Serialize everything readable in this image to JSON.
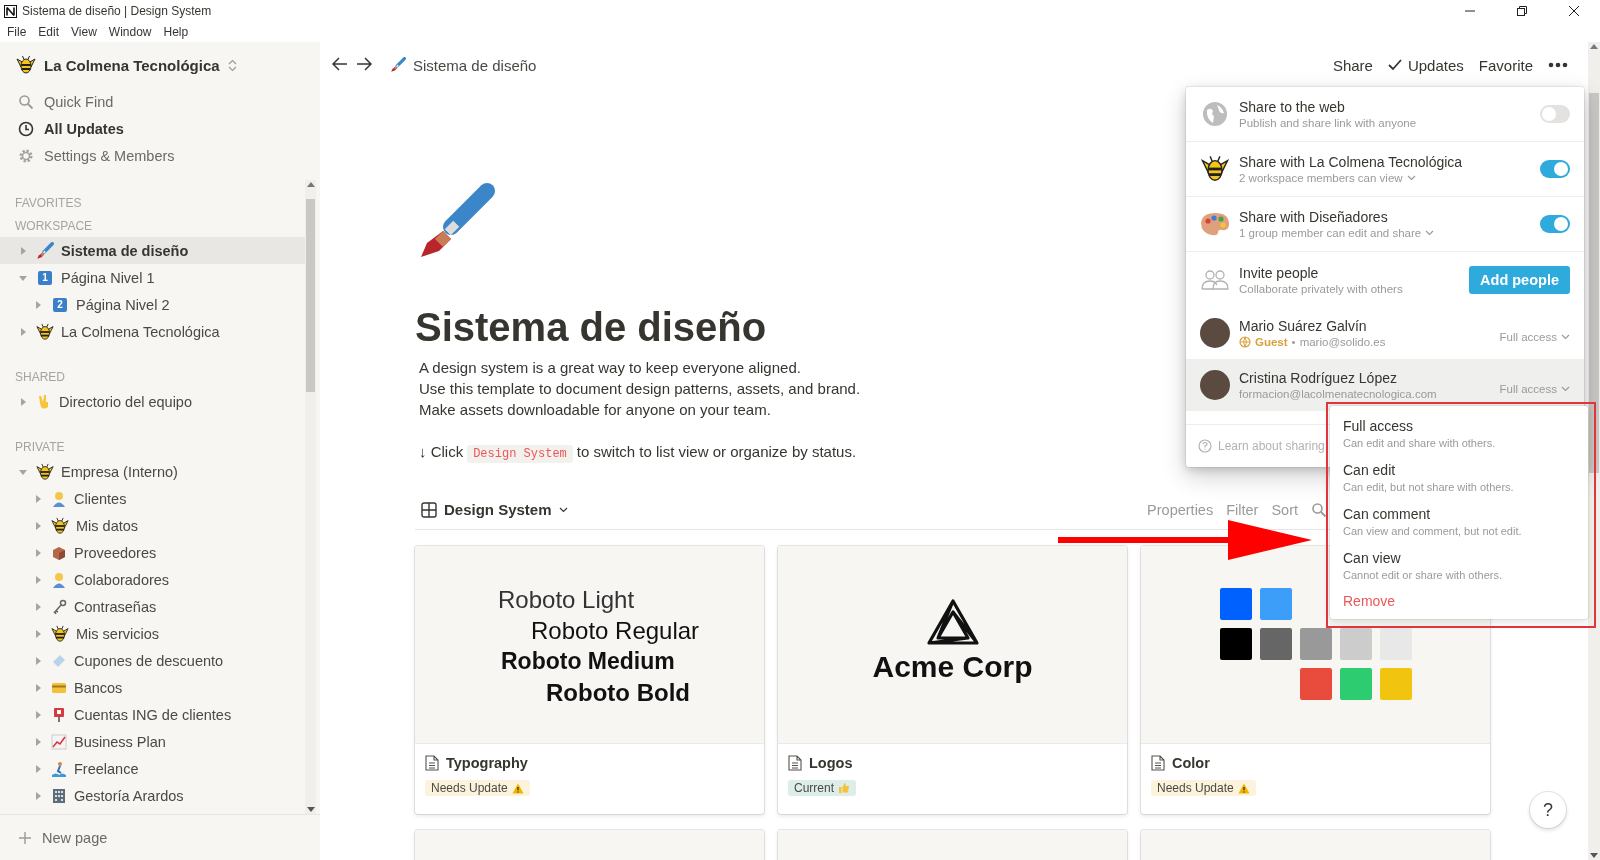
{
  "window": {
    "title": "Sistema de diseño | Design System"
  },
  "menu_bar": [
    "File",
    "Edit",
    "View",
    "Window",
    "Help"
  ],
  "sidebar": {
    "workspace_name": "La Colmena Tecnológica",
    "nav": [
      {
        "label": "Quick Find",
        "selected": false
      },
      {
        "label": "All Updates",
        "selected": true
      },
      {
        "label": "Settings & Members",
        "selected": false
      }
    ],
    "sections": [
      {
        "title": "FAVORITES"
      },
      {
        "title": "WORKSPACE",
        "items": [
          {
            "label": "Sistema de diseño",
            "expanded": false,
            "selected": true
          },
          {
            "label": "Página Nivel 1",
            "badge": "1",
            "expanded": true,
            "selected": false,
            "children": [
              {
                "label": "Página Nivel 2",
                "badge": "2",
                "expanded": false,
                "selected": false
              }
            ]
          },
          {
            "label": "La Colmena Tecnológica",
            "expanded": false,
            "selected": false
          }
        ]
      },
      {
        "title": "SHARED",
        "items": [
          {
            "label": "Directorio del equipo",
            "expanded": false,
            "selected": false
          }
        ]
      },
      {
        "title": "PRIVATE",
        "items": [
          {
            "label": "Empresa (Interno)",
            "expanded": true,
            "selected": false,
            "children": [
              {
                "label": "Clientes",
                "expanded": false,
                "selected": false
              },
              {
                "label": "Mis datos",
                "expanded": false,
                "selected": false
              },
              {
                "label": "Proveedores",
                "expanded": false,
                "selected": false
              },
              {
                "label": "Colaboradores",
                "expanded": false,
                "selected": false
              },
              {
                "label": "Contraseñas",
                "expanded": false,
                "selected": false
              },
              {
                "label": "Mis servicios",
                "expanded": false,
                "selected": false
              },
              {
                "label": "Cupones de descuento",
                "expanded": false,
                "selected": false
              },
              {
                "label": "Bancos",
                "expanded": false,
                "selected": false
              },
              {
                "label": "Cuentas ING de clientes",
                "expanded": false,
                "selected": false
              },
              {
                "label": "Business Plan",
                "expanded": false,
                "selected": false
              },
              {
                "label": "Freelance",
                "expanded": false,
                "selected": false
              },
              {
                "label": "Gestoría Arardos",
                "expanded": false,
                "selected": false
              }
            ]
          }
        ]
      }
    ],
    "new_page": "New page"
  },
  "topbar": {
    "breadcrumb": "Sistema de diseño",
    "actions": [
      {
        "label": "Share",
        "kind": "plain"
      },
      {
        "label": "Updates",
        "kind": "check"
      },
      {
        "label": "Favorite",
        "kind": "plain"
      }
    ]
  },
  "page": {
    "title": "Sistema de diseño",
    "description": [
      "A design system is a great way to keep everyone aligned.",
      "Use this template to document design patterns, assets, and brand.",
      "Make assets downloadable for anyone on your team."
    ],
    "hint": {
      "before": "↓ Click",
      "code": "Design System",
      "after": "to switch to list view or organize by status."
    }
  },
  "database": {
    "view": "Design System",
    "actions": [
      "Properties",
      "Filter",
      "Sort"
    ],
    "cards": [
      {
        "kind": "typography",
        "title": "Typography",
        "lines": [
          {
            "text": "Roboto Light",
            "kind": "light"
          },
          {
            "text": "Roboto Regular",
            "kind": "regular"
          },
          {
            "text": "Roboto Medium",
            "kind": "medium"
          },
          {
            "text": "Roboto Bold",
            "kind": "bold"
          }
        ],
        "tag": {
          "label": "Needs Update",
          "kind": "warning",
          "color": "#fbf3db"
        }
      },
      {
        "kind": "logo",
        "title": "Logos",
        "logo_text": "Acme Corp",
        "tag": {
          "label": "Current",
          "kind": "approval",
          "color": "#ddedea"
        }
      },
      {
        "kind": "swatches",
        "title": "Color",
        "swatch_rows": [
          {
            "kind": "leading",
            "swatches": [
              {
                "color": "#0061fe"
              },
              {
                "color": "#3d9efa"
              }
            ]
          },
          {
            "kind": "leading",
            "swatches": [
              {
                "color": "#000000"
              },
              {
                "color": "#666666"
              },
              {
                "color": "#999999"
              },
              {
                "color": "#cccccc"
              },
              {
                "color": "#e8e8e8"
              }
            ]
          },
          {
            "kind": "trailing",
            "swatches": [
              {
                "color": "#e94c3c"
              },
              {
                "color": "#2ecc71"
              },
              {
                "color": "#f1c40f"
              }
            ]
          }
        ],
        "tag": {
          "label": "Needs Update",
          "kind": "warning",
          "color": "#fbf3db"
        }
      },
      {
        "kind": "cut"
      },
      {
        "kind": "cut"
      },
      {
        "kind": "cut"
      }
    ]
  },
  "share_menu": {
    "options": [
      {
        "title": "Share to the web",
        "subtitle": "Publish and share link with anyone",
        "on": false,
        "dropdown": false
      },
      {
        "title": "Share with La Colmena Tecnológica",
        "subtitle": "2 workspace members can view",
        "on": true,
        "dropdown": true
      },
      {
        "title": "Share with Diseñadores",
        "subtitle": "1 group member can edit and share",
        "on": true,
        "dropdown": true
      }
    ],
    "invite": {
      "title": "Invite people",
      "subtitle": "Collaborate privately with others",
      "button": "Add people"
    },
    "members": [
      {
        "name": "Mario Suárez Galvín",
        "role": "Guest",
        "separator": "•",
        "email": "mario@solido.es",
        "access": "Full access",
        "selected": false
      },
      {
        "name": "Cristina Rodríguez López",
        "email": "formacion@lacolmenatecnologica.com",
        "access": "Full access",
        "selected": true
      }
    ],
    "footer": "Learn about sharing"
  },
  "access_menu": {
    "options": [
      {
        "title": "Full access",
        "description": "Can edit and share with others.",
        "selected": false
      },
      {
        "title": "Can edit",
        "description": "Can edit, but not share with others.",
        "selected": false
      },
      {
        "title": "Can comment",
        "description": "Can view and comment, but not edit.",
        "selected": false
      },
      {
        "title": "Can view",
        "description": "Cannot edit or share with others.",
        "selected": false
      }
    ],
    "remove": "Remove"
  },
  "help_button": "?"
}
